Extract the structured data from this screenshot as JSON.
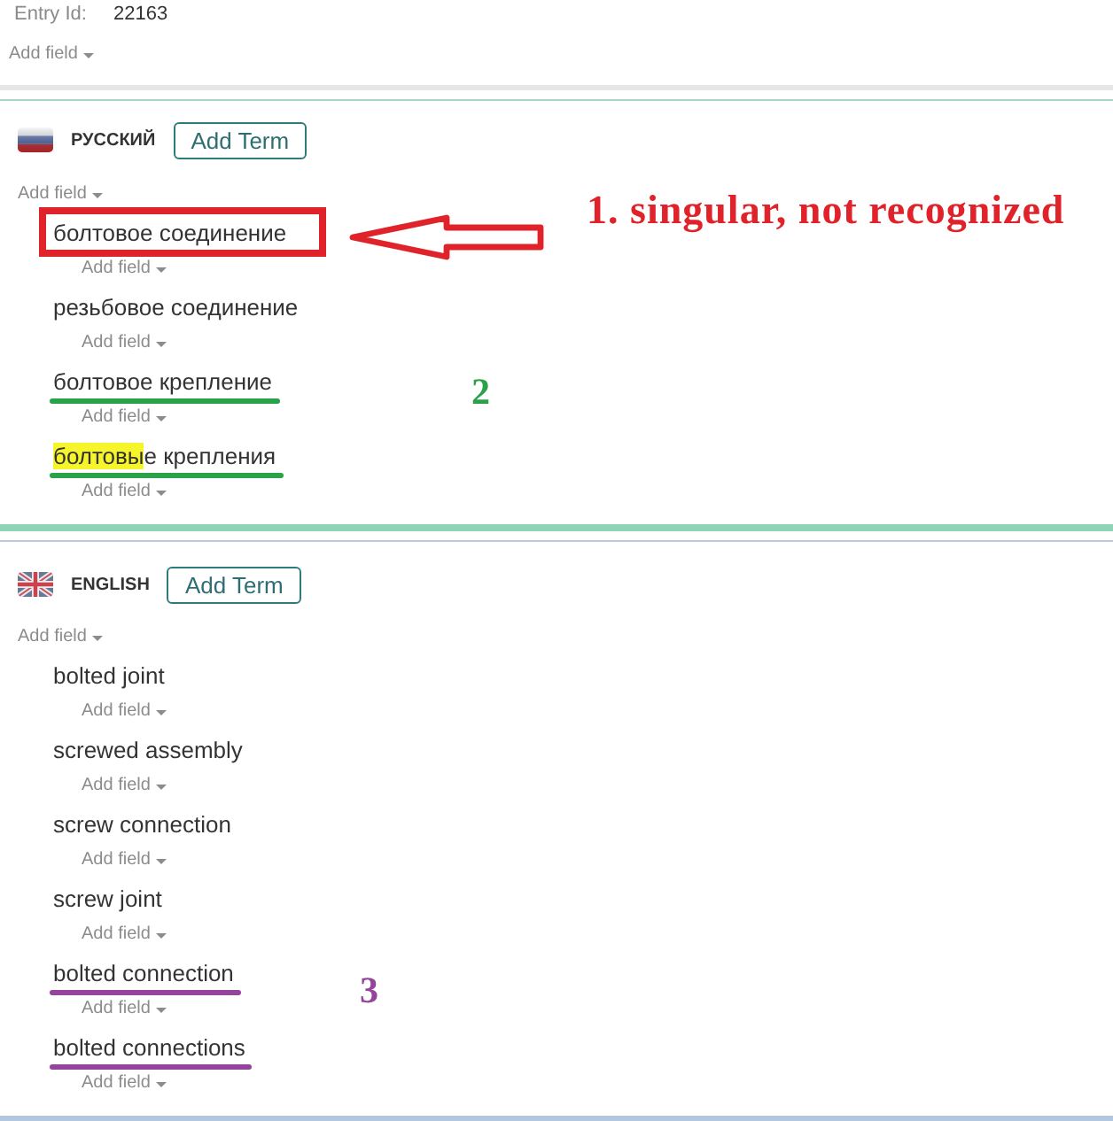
{
  "entry": {
    "label": "Entry Id:",
    "value": "22163",
    "add_field": "Add field"
  },
  "languages": [
    {
      "kind": "ru",
      "name": "РУССКИЙ",
      "add_term": "Add Term",
      "add_field": "Add field",
      "terms": [
        {
          "text": "болтовое соединение",
          "add_field": "Add field",
          "mark": {
            "kind": "box",
            "color": "#e0222a",
            "label": "1. singular, not recognized"
          }
        },
        {
          "text": "резьбовое соединение",
          "add_field": "Add field"
        },
        {
          "text": "болтовое крепление",
          "add_field": "Add field",
          "mark": {
            "kind": "underline",
            "color": "#2aa24a",
            "label": "2"
          }
        },
        {
          "segments": [
            {
              "text": "болтовы",
              "highlighted": true
            },
            {
              "text": "е крепления",
              "highlighted": false
            }
          ],
          "add_field": "Add field",
          "mark": {
            "kind": "underline",
            "color": "#2aa24a"
          }
        }
      ]
    },
    {
      "kind": "gb",
      "name": "ENGLISH",
      "add_term": "Add Term",
      "add_field": "Add field",
      "terms": [
        {
          "text": "bolted joint",
          "add_field": "Add field"
        },
        {
          "text": "screwed assembly",
          "add_field": "Add field"
        },
        {
          "text": "screw connection",
          "add_field": "Add field"
        },
        {
          "text": "screw joint",
          "add_field": "Add field"
        },
        {
          "text": "bolted connection",
          "add_field": "Add field",
          "mark": {
            "kind": "underline",
            "color": "#94449a",
            "label": "3"
          }
        },
        {
          "text": "bolted connections",
          "add_field": "Add field",
          "mark": {
            "kind": "underline",
            "color": "#94449a"
          }
        }
      ]
    }
  ]
}
